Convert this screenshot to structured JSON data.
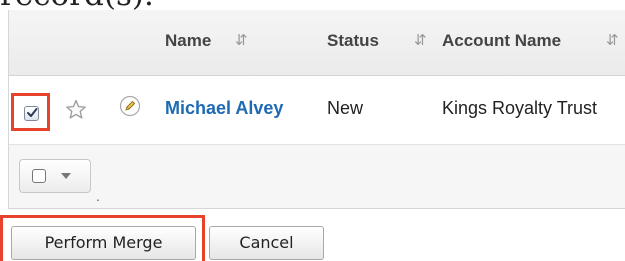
{
  "doc_fragment": "record(s).",
  "table": {
    "headers": {
      "name": "Name",
      "status": "Status",
      "account_name": "Account Name"
    },
    "rows": [
      {
        "checked": true,
        "name": "Michael Alvey",
        "status": "New",
        "account_name": "Kings Royalty Trust"
      }
    ],
    "footer_dot": "."
  },
  "buttons": {
    "perform_merge": "Perform Merge",
    "cancel": "Cancel"
  },
  "colors": {
    "highlight": "#e8412c",
    "link": "#1e6ab3"
  },
  "icons": {
    "sort": "sort-arrows-icon",
    "favorite": "star-icon",
    "edit": "pencil-icon",
    "checkbox": "checkbox-checked-icon",
    "dropdown": "chevron-down-icon"
  }
}
